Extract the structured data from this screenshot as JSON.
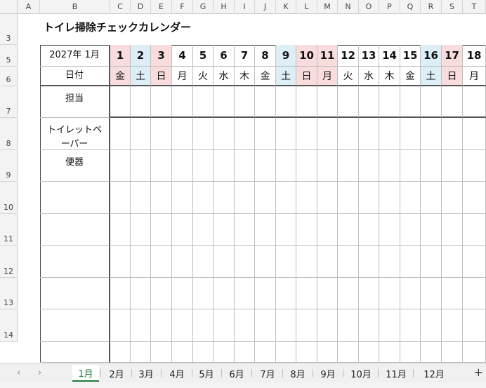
{
  "columns": [
    "A",
    "B",
    "C",
    "D",
    "E",
    "F",
    "G",
    "H",
    "I",
    "J",
    "K",
    "L",
    "M",
    "N",
    "O",
    "P",
    "Q",
    "R",
    "S",
    "T"
  ],
  "rows": [
    "3",
    "5",
    "6",
    "7",
    "8",
    "9",
    "10",
    "11",
    "12",
    "13",
    "14"
  ],
  "title": "トイレ掃除チェックカレンダー",
  "month_label": "2027年 1月",
  "date_label": "日付",
  "row_labels": [
    "担当",
    "トイレットペーパー",
    "便器"
  ],
  "days": [
    {
      "num": "1",
      "wd": "金",
      "type": "sun"
    },
    {
      "num": "2",
      "wd": "土",
      "type": "sat"
    },
    {
      "num": "3",
      "wd": "日",
      "type": "sun"
    },
    {
      "num": "4",
      "wd": "月",
      "type": ""
    },
    {
      "num": "5",
      "wd": "火",
      "type": ""
    },
    {
      "num": "6",
      "wd": "水",
      "type": ""
    },
    {
      "num": "7",
      "wd": "木",
      "type": ""
    },
    {
      "num": "8",
      "wd": "金",
      "type": ""
    },
    {
      "num": "9",
      "wd": "土",
      "type": "sat"
    },
    {
      "num": "10",
      "wd": "日",
      "type": "sun"
    },
    {
      "num": "11",
      "wd": "月",
      "type": "sun"
    },
    {
      "num": "12",
      "wd": "火",
      "type": ""
    },
    {
      "num": "13",
      "wd": "水",
      "type": ""
    },
    {
      "num": "14",
      "wd": "木",
      "type": ""
    },
    {
      "num": "15",
      "wd": "金",
      "type": ""
    },
    {
      "num": "16",
      "wd": "土",
      "type": "sat"
    },
    {
      "num": "17",
      "wd": "日",
      "type": "sun"
    },
    {
      "num": "18",
      "wd": "月",
      "type": ""
    }
  ],
  "sheet_tabs": [
    "1月",
    "2月",
    "3月",
    "4月",
    "5月",
    "6月",
    "7月",
    "8月",
    "9月",
    "10月",
    "11月",
    "12月"
  ],
  "active_tab": "1月",
  "nav": {
    "prev": "‹",
    "next": "›",
    "add": "+"
  },
  "colors": {
    "saturday": "#ddeef6",
    "sunday_holiday": "#f9dddd",
    "accent": "#1f7a3a"
  }
}
